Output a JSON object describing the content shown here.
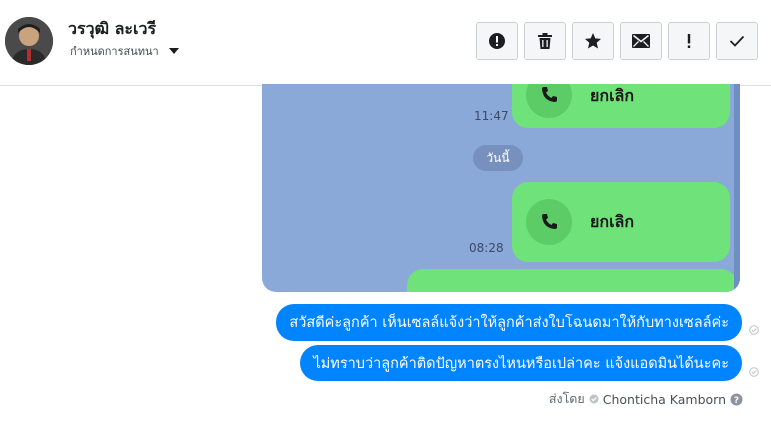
{
  "header": {
    "user_name": "วรวุฒิ ละเวรี",
    "assign_label": "กำหนดการสนทนา"
  },
  "actions": [
    {
      "name": "report-spam-button",
      "icon": "alert-circle-icon"
    },
    {
      "name": "delete-button",
      "icon": "trash-icon"
    },
    {
      "name": "star-button",
      "icon": "star-icon"
    },
    {
      "name": "mark-unread-button",
      "icon": "envelope-icon"
    },
    {
      "name": "follow-up-button",
      "icon": "exclamation-icon"
    },
    {
      "name": "mark-done-button",
      "icon": "checkmark-icon"
    }
  ],
  "screenshot_image": {
    "call_label_1": "ยกเลิก",
    "time_1": "11:47",
    "date_chip": "วันนี้",
    "call_label_2": "ยกเลิก",
    "time_2": "08:28"
  },
  "messages": [
    {
      "text": "สวัสดีค่ะลูกค้า เห็นเซลล์แจ้งว่าให้ลูกค้าส่งใบโฉนดมาให้กับทางเซลล์ค่ะ"
    },
    {
      "text": "ไม่ทราบว่าลูกค้าติดปัญหาตรงไหนหรือเปล่าคะ แจ้งแอดมินได้นะคะ"
    }
  ],
  "sent_by": {
    "label": "ส่งโดย",
    "name": "Chonticha Kamborn"
  },
  "colors": {
    "bubble": "#0084ff",
    "line_green": "#6fe27a",
    "line_bg": "#8aa8d8"
  }
}
